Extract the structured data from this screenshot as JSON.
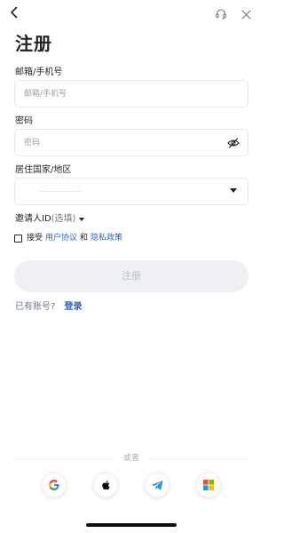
{
  "header": {
    "back_icon": "chevron-left-icon",
    "support_icon": "headset-icon",
    "close_icon": "close-icon"
  },
  "title": "注册",
  "email_phone": {
    "label": "邮箱/手机号",
    "placeholder": "邮箱/手机号",
    "value": ""
  },
  "password": {
    "label": "密码",
    "placeholder": "密码",
    "value": "",
    "toggle_icon": "eye-slash-icon"
  },
  "country": {
    "label": "居住国家/地区",
    "selected": "",
    "dropdown_icon": "caret-down-icon"
  },
  "referral": {
    "label": "邀请人ID",
    "optional": "(选填)"
  },
  "agreement": {
    "checked": false,
    "prefix": "接受",
    "terms_link": "用户协议",
    "conjunction": "和",
    "privacy_link": "隐私政策"
  },
  "register_button": "注册",
  "login_prompt": {
    "text": "已有账号?",
    "link": "登录"
  },
  "divider_text": "或者",
  "social_logins": [
    {
      "name": "google",
      "icon": "google-icon"
    },
    {
      "name": "apple",
      "icon": "apple-icon"
    },
    {
      "name": "telegram",
      "icon": "telegram-icon"
    },
    {
      "name": "microsoft",
      "icon": "microsoft-icon"
    }
  ],
  "colors": {
    "link": "#2c5fd6",
    "button_disabled_bg": "#eef0f4",
    "button_disabled_text": "#b9bec6",
    "text_primary": "#1e2329",
    "text_secondary": "#707a8a"
  }
}
